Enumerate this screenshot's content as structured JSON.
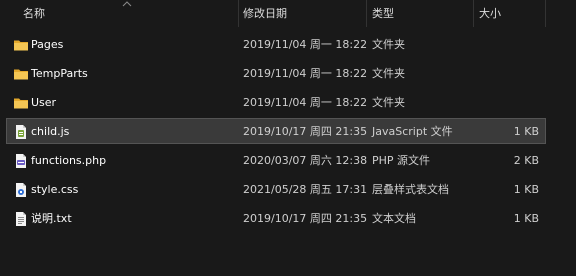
{
  "columns": {
    "name": "名称",
    "modified": "修改日期",
    "type": "类型",
    "size": "大小"
  },
  "files": [
    {
      "name": "Pages",
      "modified": "2019/11/04 周一 18:22",
      "type": "文件夹",
      "size": "",
      "icon": "folder-icon"
    },
    {
      "name": "TempParts",
      "modified": "2019/11/04 周一 18:22",
      "type": "文件夹",
      "size": "",
      "icon": "folder-icon"
    },
    {
      "name": "User",
      "modified": "2019/11/04 周一 18:22",
      "type": "文件夹",
      "size": "",
      "icon": "folder-icon"
    },
    {
      "name": "child.js",
      "modified": "2019/10/17 周四 21:35",
      "type": "JavaScript 文件",
      "size": "1 KB",
      "icon": "js-file-icon",
      "selected": true
    },
    {
      "name": "functions.php",
      "modified": "2020/03/07 周六 12:38",
      "type": "PHP 源文件",
      "size": "2 KB",
      "icon": "php-file-icon"
    },
    {
      "name": "style.css",
      "modified": "2021/05/28 周五 17:31",
      "type": "层叠样式表文档",
      "size": "1 KB",
      "icon": "css-file-icon"
    },
    {
      "name": "说明.txt",
      "modified": "2019/10/17 周四 21:35",
      "type": "文本文档",
      "size": "1 KB",
      "icon": "text-file-icon"
    }
  ],
  "colors": {
    "background": "#191919",
    "folder": "#f2c14e",
    "selection": "#3a3a3a"
  }
}
